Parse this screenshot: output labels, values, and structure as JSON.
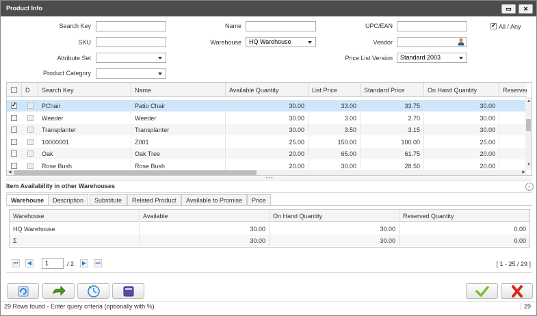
{
  "window": {
    "title": "Product Info",
    "minimize_glyph": "▭",
    "close_glyph": "✕"
  },
  "criteria": {
    "search_key_label": "Search Key",
    "name_label": "Name",
    "upc_label": "UPC/EAN",
    "all_any_label": "All / Any",
    "all_any_checked": true,
    "sku_label": "SKU",
    "warehouse_label": "Warehouse",
    "warehouse_value": "HQ Warehouse",
    "vendor_label": "Vendor",
    "attribute_set_label": "Attribute Set",
    "price_list_label": "Price List Version",
    "price_list_value": "Standard 2003",
    "category_label": "Product Category"
  },
  "grid": {
    "headers": [
      "D",
      "Search Key",
      "Name",
      "Available Quantity",
      "List Price",
      "Standard Price",
      "On Hand Quantity",
      "Reserved"
    ],
    "rows": [
      {
        "selected": true,
        "key": "PChair",
        "name": "Patio Chair",
        "avail": "30.00",
        "list": "33.00",
        "std": "33.75",
        "onhand": "30.00"
      },
      {
        "selected": false,
        "key": "Weeder",
        "name": "Weeder",
        "avail": "30.00",
        "list": "3.00",
        "std": "2.70",
        "onhand": "30.00"
      },
      {
        "selected": false,
        "key": "Transplanter",
        "name": "Transplanter",
        "avail": "30.00",
        "list": "3.50",
        "std": "3.15",
        "onhand": "30.00"
      },
      {
        "selected": false,
        "key": "10000001",
        "name": "Z001",
        "avail": "25.00",
        "list": "150.00",
        "std": "100.00",
        "onhand": "25.00"
      },
      {
        "selected": false,
        "key": "Oak",
        "name": "Oak Tree",
        "avail": "20.00",
        "list": "65.00",
        "std": "61.75",
        "onhand": "20.00"
      },
      {
        "selected": false,
        "key": "Rose Bush",
        "name": "Rose Bush",
        "avail": "20.00",
        "list": "30.00",
        "std": "28.50",
        "onhand": "20.00"
      }
    ]
  },
  "availability": {
    "title": "Item Availability in other Warehouses",
    "tabs": [
      "Warehouse",
      "Description",
      "Substitute",
      "Related Product",
      "Available to Promise",
      "Price"
    ],
    "headers": [
      "Warehouse",
      "Available",
      "On Hand Quantity",
      "Reserved Quantity"
    ],
    "rows": [
      {
        "warehouse": "HQ Warehouse",
        "available": "30.00",
        "onhand": "30.00",
        "reserved": "0.00"
      },
      {
        "warehouse": "Σ",
        "available": "30.00",
        "onhand": "30.00",
        "reserved": "0.00"
      }
    ]
  },
  "pager": {
    "page": "1",
    "of": "/ 2",
    "range": "[ 1 - 25 / 29 ]"
  },
  "status": {
    "text": "29 Rows found - Enter query criteria (optionally with %)",
    "count": "29"
  },
  "colors": {
    "accent": "#2d7dd2",
    "selected_row": "#cfe5f9",
    "titlebar": "#4d4d4d",
    "ok_green": "#4a9a1c",
    "cancel_red": "#d9261c"
  }
}
